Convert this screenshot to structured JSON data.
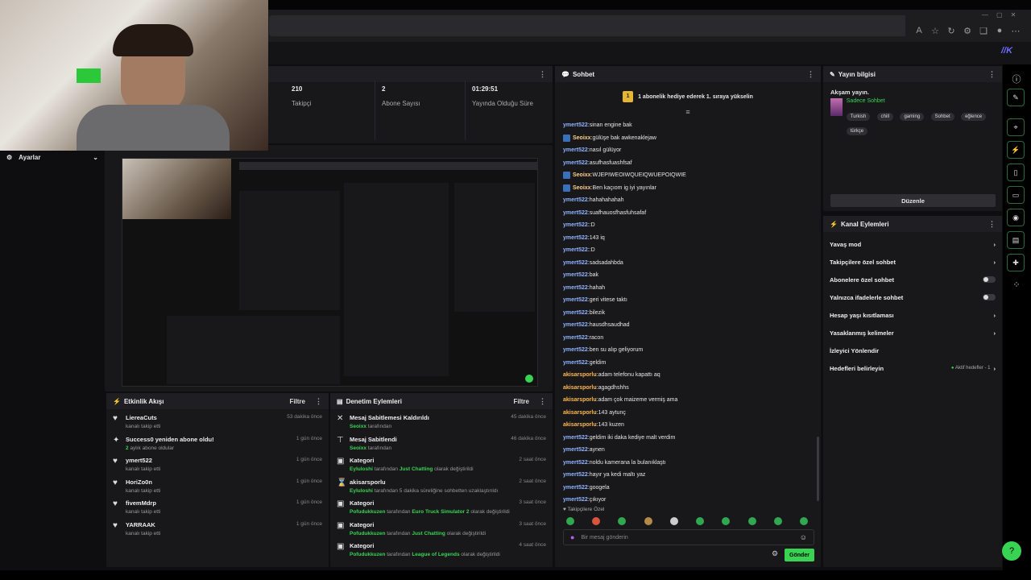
{
  "stats": [
    {
      "value": "210",
      "label": "Takipçi"
    },
    {
      "value": "2",
      "label": "Abone Sayısı"
    },
    {
      "value": "01:29:51",
      "label": "Yayında Olduğu Süre"
    }
  ],
  "settings_label": "Ayarlar",
  "activity": {
    "title": "Etkinlik Akışı",
    "filter_label": "Filtre",
    "items": [
      {
        "name": "LiereaCuts",
        "sub": "kanalı takip etti",
        "time": "53 dakika önce"
      },
      {
        "name": "Success0 yeniden abone oldu!",
        "sub_num": "2",
        "sub": "aylık abone oldular",
        "time": "1 gün önce"
      },
      {
        "name": "ymert522",
        "sub": "kanalı takip etti",
        "time": "1 gün önce"
      },
      {
        "name": "HoriZo0n",
        "sub": "kanalı takip etti",
        "time": "1 gün önce"
      },
      {
        "name": "fivemMdrp",
        "sub": "kanalı takip etti",
        "time": "1 gün önce"
      },
      {
        "name": "YARRAAK",
        "sub": "kanalı takip etti",
        "time": "1 gün önce"
      }
    ]
  },
  "moderation": {
    "title": "Denetim Eylemleri",
    "filter_label": "Filtre",
    "items": [
      {
        "icon": "unpin-icon",
        "title": "Mesaj Sabitlemesi Kaldırıldı",
        "user": "Seoixx",
        "rest": "tarafından",
        "time": "45 dakika önce"
      },
      {
        "icon": "pin-icon",
        "title": "Mesaj Sabitlendi",
        "user": "Seoixx",
        "rest": "tarafından",
        "time": "46 dakika önce"
      },
      {
        "icon": "category-icon",
        "title": "Kategori",
        "user": "Eyluloshi",
        "rest": "tarafından",
        "game": "Just Chatting",
        "rest2": "olarak değiştirildi",
        "time": "2 saat önce"
      },
      {
        "icon": "timeout-icon",
        "title": "akisarsporlu",
        "user": "Eyluloshi",
        "rest": "tarafından 5 dakika süreliğine sohbetten uzaklaştırıldı",
        "time": "2 saat önce"
      },
      {
        "icon": "category-icon",
        "title": "Kategori",
        "user": "Pofudukkuzen",
        "rest": "tarafından",
        "game": "Euro Truck Simulator 2",
        "rest2": "olarak değiştirildi",
        "time": "3 saat önce"
      },
      {
        "icon": "category-icon",
        "title": "Kategori",
        "user": "Pofudukkuzen",
        "rest": "tarafından",
        "game": "Just Chatting",
        "rest2": "olarak değiştirildi",
        "time": "3 saat önce"
      },
      {
        "icon": "category-icon",
        "title": "Kategori",
        "user": "Pofudukkuzen",
        "rest": "tarafından",
        "game": "League of Legends",
        "rest2": "olarak değiştirildi",
        "time": "4 saat önce"
      }
    ]
  },
  "chat": {
    "title": "Sohbet",
    "banner": "1 abonelik hediye ederek 1. sıraya yükselin",
    "banner_rank": "1",
    "messages": [
      {
        "user": "ymert522",
        "text": "sinan engine bak",
        "color": "blue",
        "badge": false
      },
      {
        "user": "Seoixx",
        "text": "gülüşe bak awkenaklejaw",
        "color": "seo",
        "badge": true
      },
      {
        "user": "ymert522",
        "text": "nasıl gülüyor",
        "color": "blue",
        "badge": false
      },
      {
        "user": "ymert522",
        "text": "asufhasfuashfsaf",
        "color": "blue",
        "badge": false
      },
      {
        "user": "Seoixx",
        "text": "WJEPIWEOIWQUEIQWUEPOIQWIE",
        "color": "seo",
        "badge": true
      },
      {
        "user": "Seoixx",
        "text": "Ben kaçıom ig iyi yayınlar",
        "color": "seo",
        "badge": true
      },
      {
        "user": "ymert522",
        "text": "hahahahahah",
        "color": "blue",
        "badge": false
      },
      {
        "user": "ymert522",
        "text": "suafhauosfhasfuhsafaf",
        "color": "blue",
        "badge": false
      },
      {
        "user": "ymert522",
        "text": ":D",
        "color": "blue",
        "badge": false
      },
      {
        "user": "ymert522",
        "text": "143 iq",
        "color": "blue",
        "badge": false
      },
      {
        "user": "ymert522",
        "text": ":D",
        "color": "blue",
        "badge": false
      },
      {
        "user": "ymert522",
        "text": "sadsadahbda",
        "color": "blue",
        "badge": false
      },
      {
        "user": "ymert522",
        "text": "bak",
        "color": "blue",
        "badge": false
      },
      {
        "user": "ymert522",
        "text": "hahah",
        "color": "blue",
        "badge": false
      },
      {
        "user": "ymert522",
        "text": "geri vitese taktı",
        "color": "blue",
        "badge": false
      },
      {
        "user": "ymert522",
        "text": "bilezik",
        "color": "blue",
        "badge": false
      },
      {
        "user": "ymert522",
        "text": "hausdhsaudhad",
        "color": "blue",
        "badge": false
      },
      {
        "user": "ymert522",
        "text": "racon",
        "color": "blue",
        "badge": false
      },
      {
        "user": "ymert522",
        "text": "ben su alıp geliyorum",
        "color": "blue",
        "badge": false
      },
      {
        "user": "ymert522",
        "text": "geldim",
        "color": "blue",
        "badge": false
      },
      {
        "user": "akisarsporlu",
        "text": "adam telefonu kapattı aq",
        "color": "orange",
        "badge": false
      },
      {
        "user": "akisarsporlu",
        "text": "agagdhshhs",
        "color": "orange",
        "badge": false
      },
      {
        "user": "akisarsporlu",
        "text": "adam çok maizeme vermiş ama",
        "color": "orange",
        "badge": false
      },
      {
        "user": "akisarsporlu",
        "text": "143 aytunç",
        "color": "orange",
        "badge": false
      },
      {
        "user": "akisarsporlu",
        "text": "143 kuzen",
        "color": "orange",
        "badge": false
      },
      {
        "user": "ymert522",
        "text": "geldim iki daka kediye malt verdim",
        "color": "blue",
        "badge": false
      },
      {
        "user": "ymert522",
        "text": "aynen",
        "color": "blue",
        "badge": false
      },
      {
        "user": "ymert522",
        "text": "noldu kamerana la bulanıklaştı",
        "color": "blue",
        "badge": false
      },
      {
        "user": "ymert522",
        "text": "hayır ya kedi maltı yaz",
        "color": "blue",
        "badge": false
      },
      {
        "user": "ymert522",
        "text": "googela",
        "color": "blue",
        "badge": false
      },
      {
        "user": "ymert522",
        "text": "çıkıyor",
        "color": "blue",
        "badge": false
      }
    ],
    "followers_only": "Takipçilere Özel",
    "input_placeholder": "Bir mesaj gönderin",
    "send_label": "Gönder"
  },
  "stream_info": {
    "title": "Yayın bilgisi",
    "stream_title": "Akşam yayın.",
    "category": "Sadece Sohbet",
    "tags": [
      "Turkish",
      "chill",
      "gaming",
      "Sohbet",
      "eğlence",
      "türkçe"
    ],
    "edit_label": "Düzenle"
  },
  "channel_actions": {
    "title": "Kanal Eylemleri",
    "items": [
      {
        "label": "Yavaş mod",
        "control": "chevron"
      },
      {
        "label": "Takipçilere özel sohbet",
        "control": "chevron"
      },
      {
        "label": "Abonelere özel sohbet",
        "control": "toggle"
      },
      {
        "label": "Yalnızca ifadelerle sohbet",
        "control": "toggle"
      },
      {
        "label": "Hesap yaşı kısıtlaması",
        "control": "chevron"
      },
      {
        "label": "Yasaklanmış kelimeler",
        "control": "chevron"
      },
      {
        "label": "İzleyici Yönlendir",
        "control": "none"
      },
      {
        "label": "Hedefleri belirleyin",
        "control": "chevron",
        "extra": "Aktif hedefler - 1"
      }
    ]
  },
  "colors": {
    "accent": "#39d353",
    "panel": "#18181b",
    "background": "#0e0e10"
  }
}
